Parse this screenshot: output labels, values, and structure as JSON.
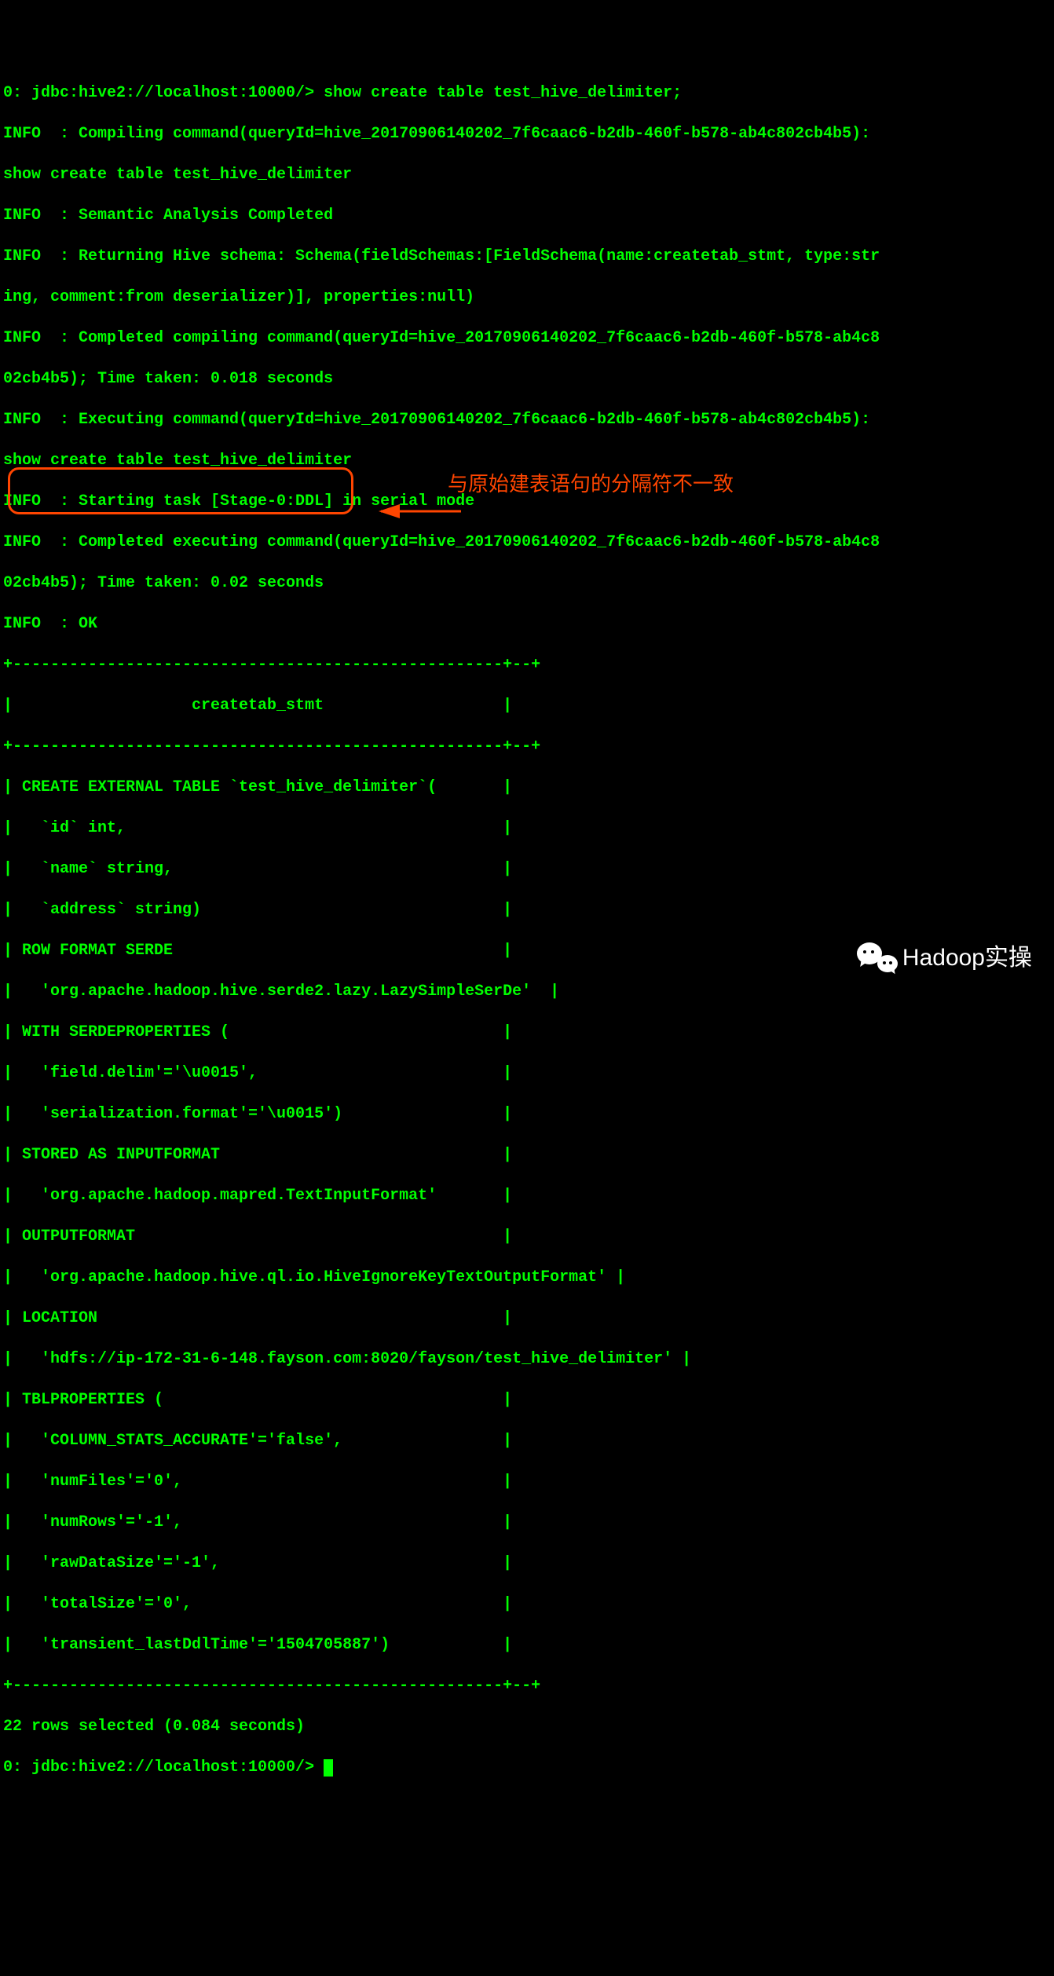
{
  "prompt1": "0: jdbc:hive2://localhost:10000/> show create table test_hive_delimiter;",
  "log": {
    "l1a": "INFO  : Compiling command(queryId=hive_20170906140202_7f6caac6-b2db-460f-b578-ab4c802cb4b5):",
    "l1b": "show create table test_hive_delimiter",
    "l2": "INFO  : Semantic Analysis Completed",
    "l3a": "INFO  : Returning Hive schema: Schema(fieldSchemas:[FieldSchema(name:createtab_stmt, type:str",
    "l3b": "ing, comment:from deserializer)], properties:null)",
    "l4a": "INFO  : Completed compiling command(queryId=hive_20170906140202_7f6caac6-b2db-460f-b578-ab4c8",
    "l4b": "02cb4b5); Time taken: 0.018 seconds",
    "l5a": "INFO  : Executing command(queryId=hive_20170906140202_7f6caac6-b2db-460f-b578-ab4c802cb4b5):",
    "l5b": "show create table test_hive_delimiter",
    "l6": "INFO  : Starting task [Stage-0:DDL] in serial mode",
    "l7a": "INFO  : Completed executing command(queryId=hive_20170906140202_7f6caac6-b2db-460f-b578-ab4c8",
    "l7b": "02cb4b5); Time taken: 0.02 seconds",
    "l8": "INFO  : OK"
  },
  "table": {
    "sep": "+----------------------------------------------------+--+",
    "hdr": "|                   createtab_stmt                   |",
    "r1": "| CREATE EXTERNAL TABLE `test_hive_delimiter`(       |",
    "r2": "|   `id` int,                                        |",
    "r3": "|   `name` string,                                   |",
    "r4": "|   `address` string)                                |",
    "r5": "| ROW FORMAT SERDE                                   |",
    "r6": "|   'org.apache.hadoop.hive.serde2.lazy.LazySimpleSerDe'  |",
    "r7": "| WITH SERDEPROPERTIES (                             |",
    "r8": "|   'field.delim'='\\u0015',                          |",
    "r9": "|   'serialization.format'='\\u0015')                 |",
    "r10": "| STORED AS INPUTFORMAT                              |",
    "r11": "|   'org.apache.hadoop.mapred.TextInputFormat'       |",
    "r12": "| OUTPUTFORMAT                                       |",
    "r13": "|   'org.apache.hadoop.hive.ql.io.HiveIgnoreKeyTextOutputFormat' |",
    "r14": "| LOCATION                                           |",
    "r15": "|   'hdfs://ip-172-31-6-148.fayson.com:8020/fayson/test_hive_delimiter' |",
    "r16": "| TBLPROPERTIES (                                    |",
    "r17": "|   'COLUMN_STATS_ACCURATE'='false',                 |",
    "r18": "|   'numFiles'='0',                                  |",
    "r19": "|   'numRows'='-1',                                  |",
    "r20": "|   'rawDataSize'='-1',                              |",
    "r21": "|   'totalSize'='0',                                 |",
    "r22": "|   'transient_lastDdlTime'='1504705887')            |"
  },
  "summary": "22 rows selected (0.084 seconds)",
  "prompt2": "0: jdbc:hive2://localhost:10000/> ",
  "annotation": "与原始建表语句的分隔符不一致",
  "watermark": "Hadoop实操"
}
